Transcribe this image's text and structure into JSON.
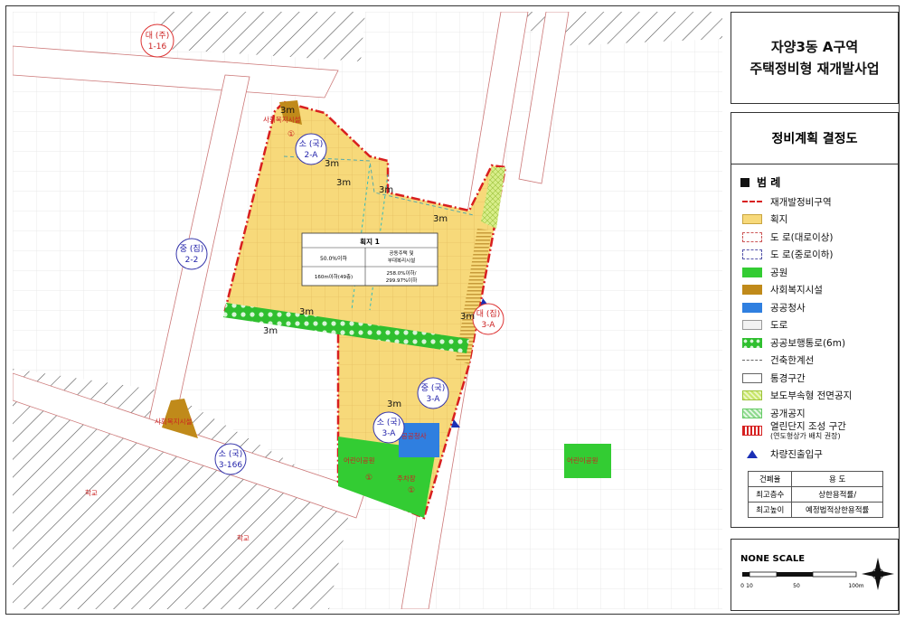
{
  "title": {
    "line1": "자양3동 A구역",
    "line2": "주택정비형 재개발사업"
  },
  "legend": {
    "heading": "정비계획 결정도",
    "title": "범  례",
    "items": [
      {
        "label": "재개발정비구역",
        "icon": "boundary-line"
      },
      {
        "label": "획지",
        "icon": "lot-fill",
        "color": "#f7d97a"
      },
      {
        "label": "도 로(대로이상)",
        "icon": "road-major"
      },
      {
        "label": "도 로(중로이하)",
        "icon": "road-minor"
      },
      {
        "label": "공원",
        "icon": "park-fill",
        "color": "#33cc33"
      },
      {
        "label": "사회복지시설",
        "icon": "welfare-fill",
        "color": "#c08a1a"
      },
      {
        "label": "공공청사",
        "icon": "government-fill",
        "color": "#2f7fe0"
      },
      {
        "label": "도로",
        "icon": "road-fill",
        "color": "#f2f2f2"
      },
      {
        "label": "공공보행통로(6m)",
        "icon": "walkway-pattern",
        "color": "#33cc33"
      },
      {
        "label": "건축한계선",
        "icon": "building-line"
      },
      {
        "label": "통경구간",
        "icon": "view-corridor"
      },
      {
        "label": "보도부속형 전면공지",
        "icon": "front-space-hatch",
        "color": "#c8e66a"
      },
      {
        "label": "공개공지",
        "icon": "open-space-hatch",
        "color": "#8fd98f"
      },
      {
        "label": "열린단지 조성 구간",
        "sub": "(연도형상가 배치 권장)",
        "icon": "open-complex-stripes",
        "color": "#d62020"
      },
      {
        "label": "차량진출입구",
        "icon": "vehicle-entrance-triangle",
        "color": "#1a2fb5"
      }
    ],
    "table": {
      "header": [
        "건폐율",
        "용 도"
      ],
      "rows": [
        [
          "최고층수",
          "상한용적률/"
        ],
        [
          "최고높이",
          "예정법적상한용적률"
        ]
      ]
    }
  },
  "scale": {
    "label": "NONE SCALE",
    "ticks": [
      "0",
      "10",
      "50",
      "100m"
    ]
  },
  "map": {
    "lot_table": {
      "title": "획지 1",
      "cell_coverage": "50.0%이하",
      "cell_use": "공동주택 및\n부대복리시설",
      "cell_height": "160m이하(49층)",
      "cell_far": "258.0%이하/\n299.97%이하"
    },
    "road_labels": [
      {
        "top": "대 (주)",
        "bottom": "1-16"
      },
      {
        "top": "소 (국)",
        "bottom": "2-A"
      },
      {
        "top": "중 (집)",
        "bottom": "2-2"
      },
      {
        "top": "대 (집)",
        "bottom": "3-A"
      },
      {
        "top": "중 (국)",
        "bottom": "3-A"
      },
      {
        "top": "소 (국)",
        "bottom": "3-A"
      },
      {
        "top": "소 (국)",
        "bottom": "3-166"
      }
    ],
    "setback_labels": [
      "3m",
      "3m",
      "3m",
      "3m",
      "3m",
      "3m",
      "3m",
      "3m",
      "3m"
    ],
    "facility_labels": {
      "welfare_top": "사회복지시설",
      "welfare_left": "사회복지시설",
      "childrens_park": "어린이공원",
      "parking": "주차장",
      "park_east": "어린이공원",
      "government": "공공청사",
      "school1": "학교",
      "school2": "학교",
      "circled_one": "①"
    }
  }
}
